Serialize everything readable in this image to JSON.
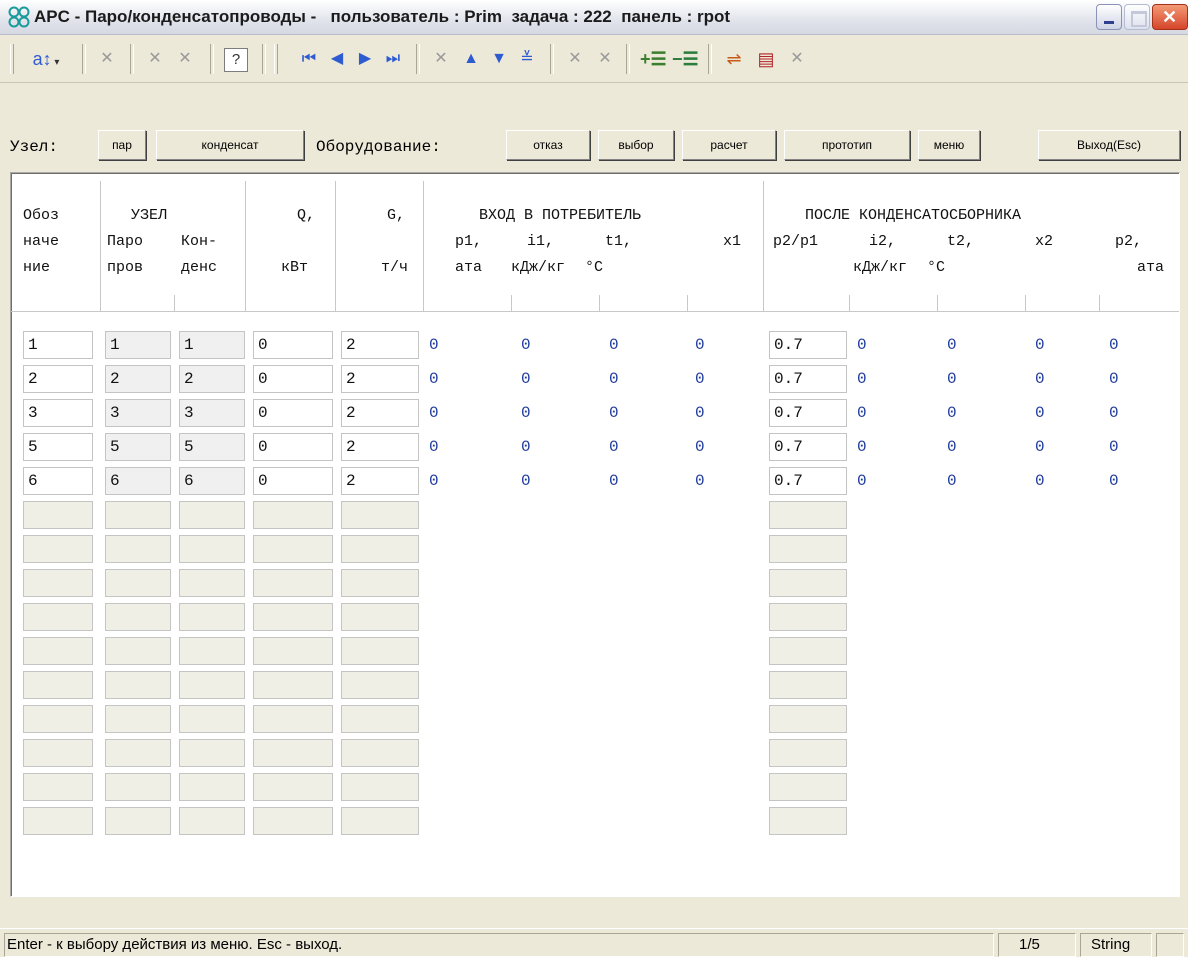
{
  "window": {
    "title": "APC - Паро/конденсатопроводы -   пользователь : Prim  задача : 222  панель : rpot"
  },
  "toolbar": {
    "sort_label": "a↕"
  },
  "buttonbar": {
    "node_label": "Узел:",
    "btn_par": "пар",
    "btn_kondensat": "конденсат",
    "equip_label": "Оборудование:",
    "btn_otkaz": "отказ",
    "btn_vybor": "выбор",
    "btn_raschet": "расчет",
    "btn_prototip": "прототип",
    "btn_menu": "меню",
    "btn_exit": "Выход(Esc)"
  },
  "headers": {
    "oboz1": "Обоз",
    "oboz2": "наче",
    "oboz3": "ние",
    "uzel": "УЗЕЛ",
    "paro1": "Паро",
    "paro2": "пров",
    "kon1": "Кон-",
    "kon2": "денс",
    "q1": "Q,",
    "q2": "кВт",
    "g1": "G,",
    "g2": "т/ч",
    "vhod": "ВХОД В ПОТРЕБИТЕЛЬ",
    "p1a": "p1,",
    "p1b": "ата",
    "i1a": "i1,",
    "i1b": "кДж/кг",
    "t1a": "t1,",
    "t1b": "°С",
    "x1": "x1",
    "posle": "ПОСЛЕ КОНДЕНСАТОСБОРНИКА",
    "p2p1": "p2/p1",
    "i2a": "i2,",
    "i2b": "кДж/кг",
    "t2a": "t2,",
    "t2b": "°С",
    "x2": "x2",
    "p2a": "p2,",
    "p2b": "ата"
  },
  "rows": [
    {
      "oboz": "1",
      "paro": "1",
      "kond": "1",
      "q": "0",
      "g": "2",
      "p1": "0",
      "i1": "0",
      "t1": "0",
      "x1": "0",
      "p2p1": "0.7",
      "i2": "0",
      "t2": "0",
      "x2": "0",
      "p2": "0"
    },
    {
      "oboz": "2",
      "paro": "2",
      "kond": "2",
      "q": "0",
      "g": "2",
      "p1": "0",
      "i1": "0",
      "t1": "0",
      "x1": "0",
      "p2p1": "0.7",
      "i2": "0",
      "t2": "0",
      "x2": "0",
      "p2": "0"
    },
    {
      "oboz": "3",
      "paro": "3",
      "kond": "3",
      "q": "0",
      "g": "2",
      "p1": "0",
      "i1": "0",
      "t1": "0",
      "x1": "0",
      "p2p1": "0.7",
      "i2": "0",
      "t2": "0",
      "x2": "0",
      "p2": "0"
    },
    {
      "oboz": "5",
      "paro": "5",
      "kond": "5",
      "q": "0",
      "g": "2",
      "p1": "0",
      "i1": "0",
      "t1": "0",
      "x1": "0",
      "p2p1": "0.7",
      "i2": "0",
      "t2": "0",
      "x2": "0",
      "p2": "0"
    },
    {
      "oboz": "6",
      "paro": "6",
      "kond": "6",
      "q": "0",
      "g": "2",
      "p1": "0",
      "i1": "0",
      "t1": "0",
      "x1": "0",
      "p2p1": "0.7",
      "i2": "0",
      "t2": "0",
      "x2": "0",
      "p2": "0"
    }
  ],
  "status": {
    "message": "Enter - к выбору действия из меню.  Esc - выход.",
    "record": "1/5",
    "type": "String"
  },
  "colors": {
    "value_blue": "#1f3b9d",
    "close_red": "#d6452a",
    "nav_blue": "#2f5bd1"
  },
  "icons": [
    "app-icon",
    "sort-icon",
    "first-record-icon",
    "prev-record-icon",
    "next-record-icon",
    "last-record-icon",
    "up-icon",
    "down-icon",
    "sum-icon",
    "add-row-icon",
    "delete-row-icon",
    "tool-icon",
    "stack-icon",
    "help-icon"
  ]
}
